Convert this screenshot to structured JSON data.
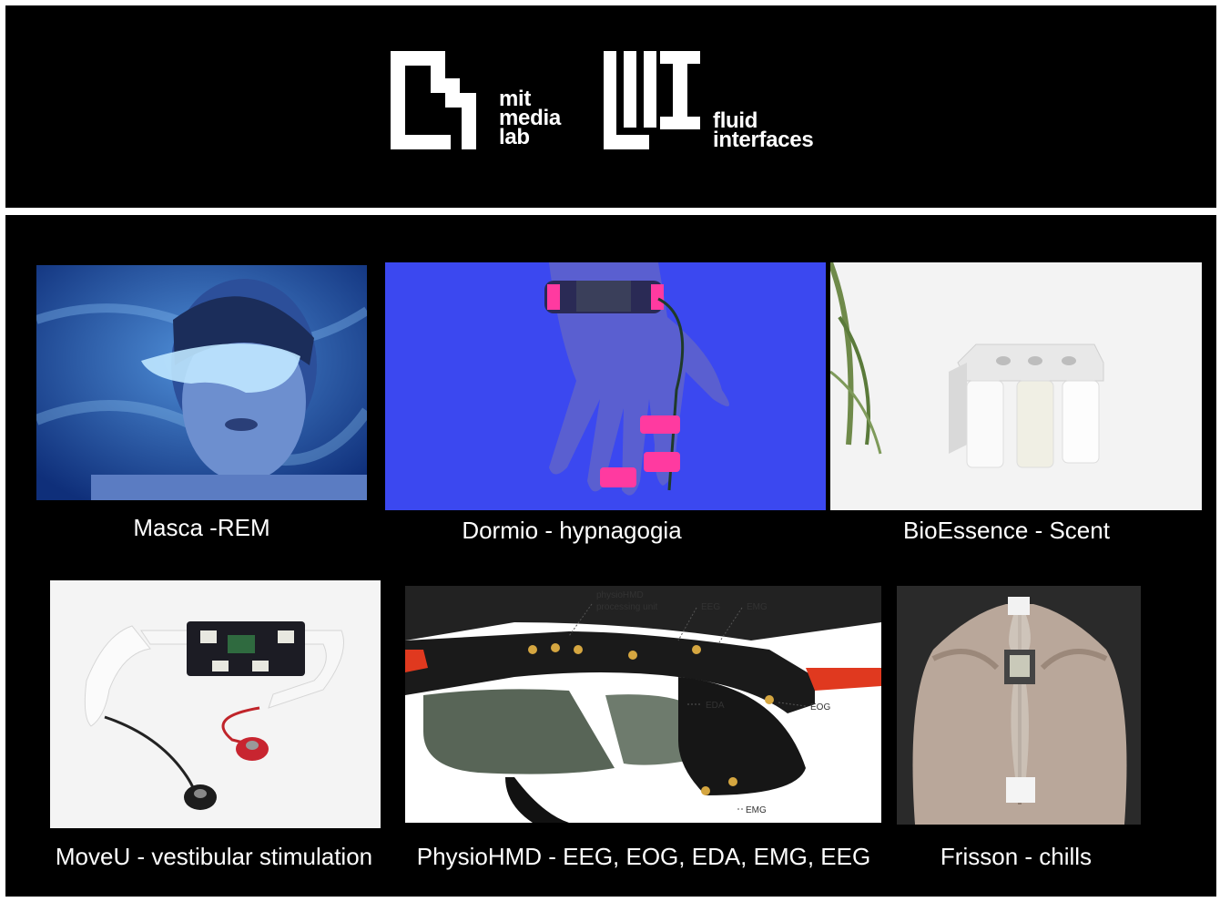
{
  "header": {
    "logos": [
      {
        "name": "mit-media-lab",
        "lines": [
          "mit",
          "media",
          "lab"
        ]
      },
      {
        "name": "fluid-interfaces",
        "lines": [
          "fluid",
          "interfaces"
        ]
      }
    ]
  },
  "projects": [
    {
      "caption": "Masca -REM",
      "icon": "sleep-mask-photo"
    },
    {
      "caption": "Dormio - hypnagogia",
      "icon": "hand-sensor-photo"
    },
    {
      "caption": "BioEssence - Scent",
      "icon": "scent-device-photo"
    },
    {
      "caption": "MoveU - vestibular stimulation",
      "icon": "headset-electrode-photo"
    },
    {
      "caption": "PhysioHMD - EEG, EOG, EDA, EMG, EEG",
      "icon": "hmd-sensor-photo"
    },
    {
      "caption": "Frisson - chills",
      "icon": "back-wearable-photo"
    }
  ],
  "physiohmd_labels": {
    "unit_line1": "physioHMD",
    "unit_line2": "processing unit",
    "eeg": "EEG",
    "emg_top": "EMG",
    "eda": "EDA",
    "eog": "EOG",
    "emg_bottom": "EMG"
  },
  "colors": {
    "background": "#000000",
    "frame": "#ffffff",
    "text": "#ffffff",
    "accent_blue": "#3b48f0",
    "accent_pink": "#ff3aa0"
  }
}
